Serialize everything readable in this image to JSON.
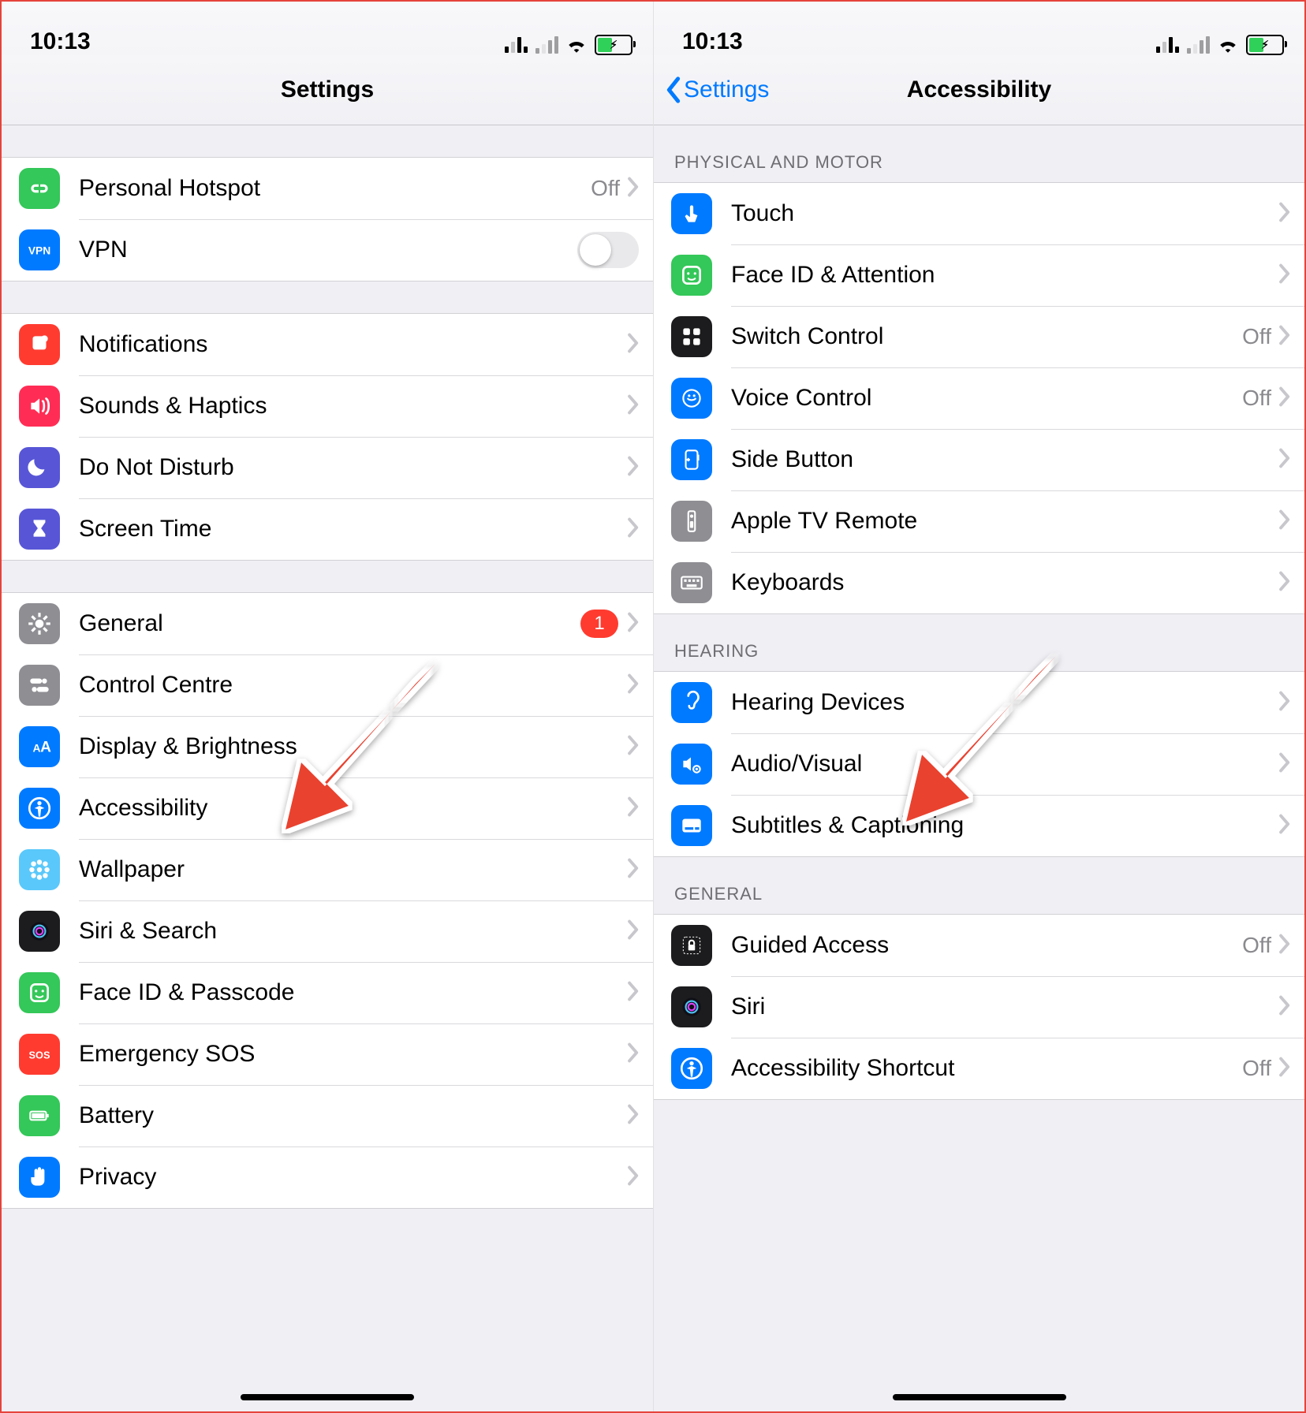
{
  "status_time": "10:13",
  "left": {
    "title": "Settings",
    "sections": [
      {
        "header": "",
        "rows": [
          {
            "id": "hotspot",
            "label": "Personal Hotspot",
            "value": "Off",
            "iconColor": "#34c759",
            "icon": "link"
          },
          {
            "id": "vpn",
            "label": "VPN",
            "iconColor": "#007aff",
            "icon": "vpn",
            "toggle": true
          }
        ]
      },
      {
        "header": "",
        "rows": [
          {
            "id": "notifications",
            "label": "Notifications",
            "iconColor": "#ff3b30",
            "icon": "bell"
          },
          {
            "id": "sounds",
            "label": "Sounds & Haptics",
            "iconColor": "#ff2d55",
            "icon": "speaker"
          },
          {
            "id": "dnd",
            "label": "Do Not Disturb",
            "iconColor": "#5856d6",
            "icon": "moon"
          },
          {
            "id": "screentime",
            "label": "Screen Time",
            "iconColor": "#5856d6",
            "icon": "hourglass"
          }
        ]
      },
      {
        "header": "",
        "rows": [
          {
            "id": "general",
            "label": "General",
            "iconColor": "#8e8e93",
            "icon": "gear",
            "badge": "1"
          },
          {
            "id": "controlcentre",
            "label": "Control Centre",
            "iconColor": "#8e8e93",
            "icon": "switches"
          },
          {
            "id": "display",
            "label": "Display & Brightness",
            "iconColor": "#007aff",
            "icon": "aa"
          },
          {
            "id": "accessibility",
            "label": "Accessibility",
            "iconColor": "#007aff",
            "icon": "person"
          },
          {
            "id": "wallpaper",
            "label": "Wallpaper",
            "iconColor": "#5ac8fa",
            "icon": "flower"
          },
          {
            "id": "siri",
            "label": "Siri & Search",
            "iconColor": "#1c1c1e",
            "icon": "siri"
          },
          {
            "id": "faceid",
            "label": "Face ID & Passcode",
            "iconColor": "#34c759",
            "icon": "face"
          },
          {
            "id": "sos",
            "label": "Emergency SOS",
            "iconColor": "#ff3b30",
            "icon": "sos"
          },
          {
            "id": "battery",
            "label": "Battery",
            "iconColor": "#34c759",
            "icon": "battery"
          },
          {
            "id": "privacy",
            "label": "Privacy",
            "iconColor": "#007aff",
            "icon": "hand"
          }
        ]
      }
    ]
  },
  "right": {
    "title": "Accessibility",
    "back_label": "Settings",
    "sections": [
      {
        "header": "PHYSICAL AND MOTOR",
        "rows": [
          {
            "id": "touch",
            "label": "Touch",
            "iconColor": "#007aff",
            "icon": "touch"
          },
          {
            "id": "faceatt",
            "label": "Face ID & Attention",
            "iconColor": "#34c759",
            "icon": "face"
          },
          {
            "id": "switchctl",
            "label": "Switch Control",
            "value": "Off",
            "iconColor": "#1c1c1e",
            "icon": "grid"
          },
          {
            "id": "voicectl",
            "label": "Voice Control",
            "value": "Off",
            "iconColor": "#007aff",
            "icon": "voice"
          },
          {
            "id": "sidebtn",
            "label": "Side Button",
            "iconColor": "#007aff",
            "icon": "side"
          },
          {
            "id": "tvremote",
            "label": "Apple TV Remote",
            "iconColor": "#8e8e93",
            "icon": "remote"
          },
          {
            "id": "keyboards",
            "label": "Keyboards",
            "iconColor": "#8e8e93",
            "icon": "keyboard"
          }
        ]
      },
      {
        "header": "HEARING",
        "rows": [
          {
            "id": "hearingdev",
            "label": "Hearing Devices",
            "iconColor": "#007aff",
            "icon": "ear"
          },
          {
            "id": "audiovisual",
            "label": "Audio/Visual",
            "iconColor": "#007aff",
            "icon": "audiovisual"
          },
          {
            "id": "subtitles",
            "label": "Subtitles & Captioning",
            "iconColor": "#007aff",
            "icon": "subtitles"
          }
        ]
      },
      {
        "header": "GENERAL",
        "rows": [
          {
            "id": "guided",
            "label": "Guided Access",
            "value": "Off",
            "iconColor": "#1c1c1e",
            "icon": "lock"
          },
          {
            "id": "siri2",
            "label": "Siri",
            "iconColor": "#1c1c1e",
            "icon": "siri"
          },
          {
            "id": "shortcut",
            "label": "Accessibility Shortcut",
            "value": "Off",
            "iconColor": "#007aff",
            "icon": "person"
          }
        ]
      }
    ]
  },
  "arrows": {
    "left_target": "accessibility",
    "right_target": "audiovisual"
  }
}
